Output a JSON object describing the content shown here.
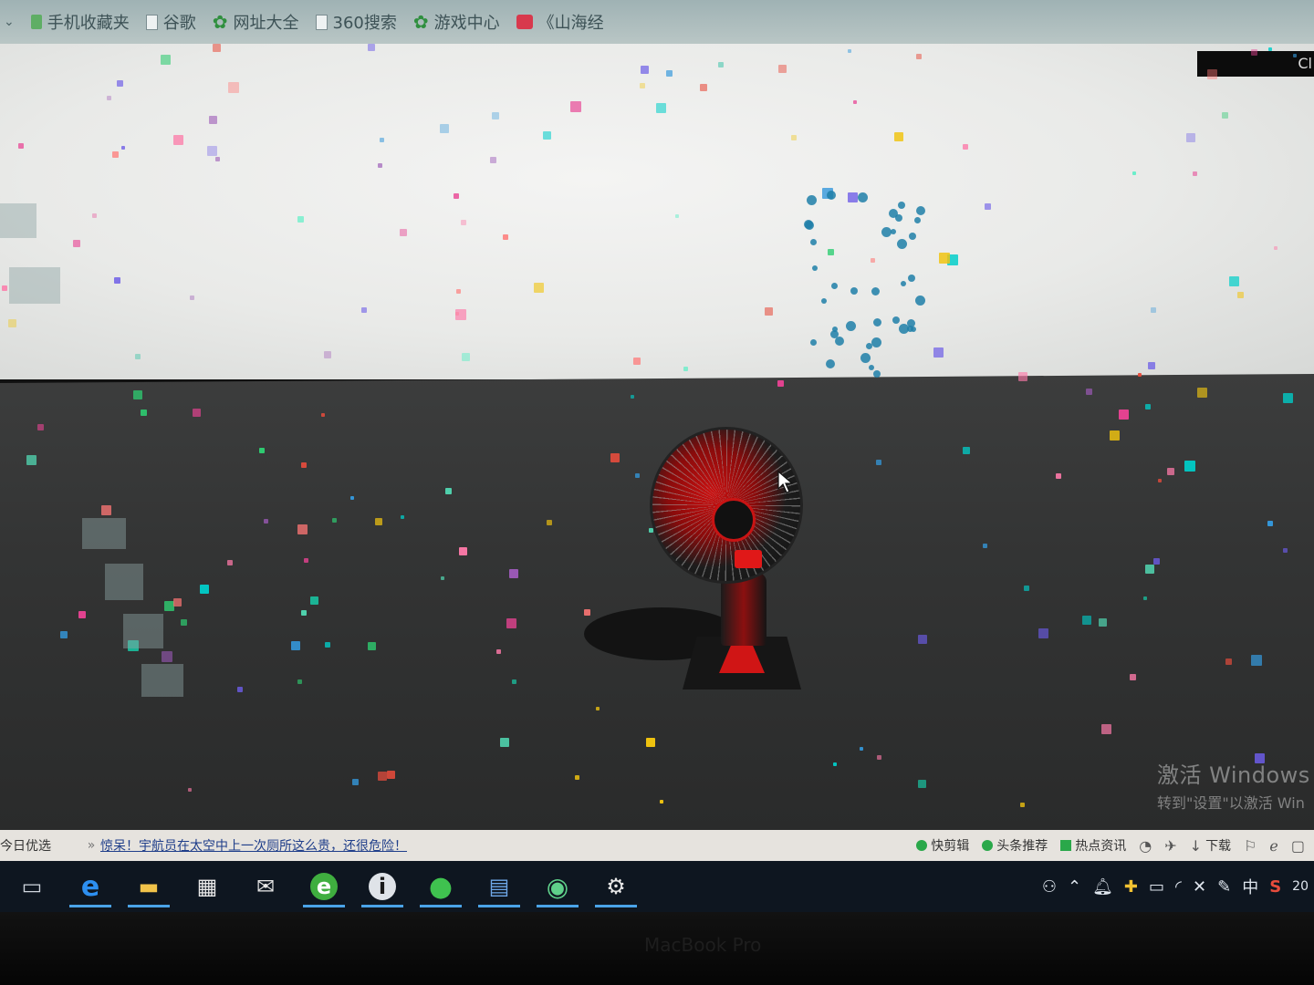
{
  "bookmarks": [
    {
      "label": "手机收藏夹",
      "icon": "folder-icon"
    },
    {
      "label": "谷歌",
      "icon": "page-icon"
    },
    {
      "label": "网址大全",
      "icon": "star-icon"
    },
    {
      "label": "360搜索",
      "icon": "page-icon"
    },
    {
      "label": "游戏中心",
      "icon": "star-icon"
    },
    {
      "label": "《山海经",
      "icon": "game-icon"
    }
  ],
  "scene": {
    "corner_text": "Cl",
    "watermark_title": "激活 Windows",
    "watermark_sub": "转到\"设置\"以激活 Win"
  },
  "news": {
    "left_label": "今日优选",
    "separator": "»",
    "headline": "惊呆！宇航员在太空中上一次厕所这么贵，还很危险！",
    "items": [
      {
        "label": "快剪辑",
        "icon": "play-icon"
      },
      {
        "label": "头条推荐",
        "icon": "dot-icon"
      },
      {
        "label": "热点资讯",
        "icon": "news-icon"
      },
      {
        "label": "",
        "icon": "speed-icon"
      },
      {
        "label": "",
        "icon": "pin-icon"
      },
      {
        "label": "下载",
        "icon": "download-icon"
      }
    ]
  },
  "taskbar": {
    "apps": [
      {
        "name": "task-view-icon",
        "glyph": "▭"
      },
      {
        "name": "edge-icon",
        "glyph": "e"
      },
      {
        "name": "file-explorer-icon",
        "glyph": "▬"
      },
      {
        "name": "store-icon",
        "glyph": "▦"
      },
      {
        "name": "mail-icon",
        "glyph": "✉"
      },
      {
        "name": "browser-360-icon",
        "glyph": "e"
      },
      {
        "name": "app-i-icon",
        "glyph": "i"
      },
      {
        "name": "wechat-icon",
        "glyph": "●"
      },
      {
        "name": "image-viewer-icon",
        "glyph": "▤"
      },
      {
        "name": "app-green-icon",
        "glyph": "◉"
      },
      {
        "name": "settings-icon",
        "glyph": "⚙"
      }
    ],
    "tray": {
      "ime_label": "中",
      "clock": "20"
    }
  },
  "bezel": {
    "label": "MacBook Pro"
  },
  "colors": {
    "fan_red": "#d01515",
    "taskbar_bg": "#0e1620",
    "accent_blue": "#4aa3e8"
  }
}
